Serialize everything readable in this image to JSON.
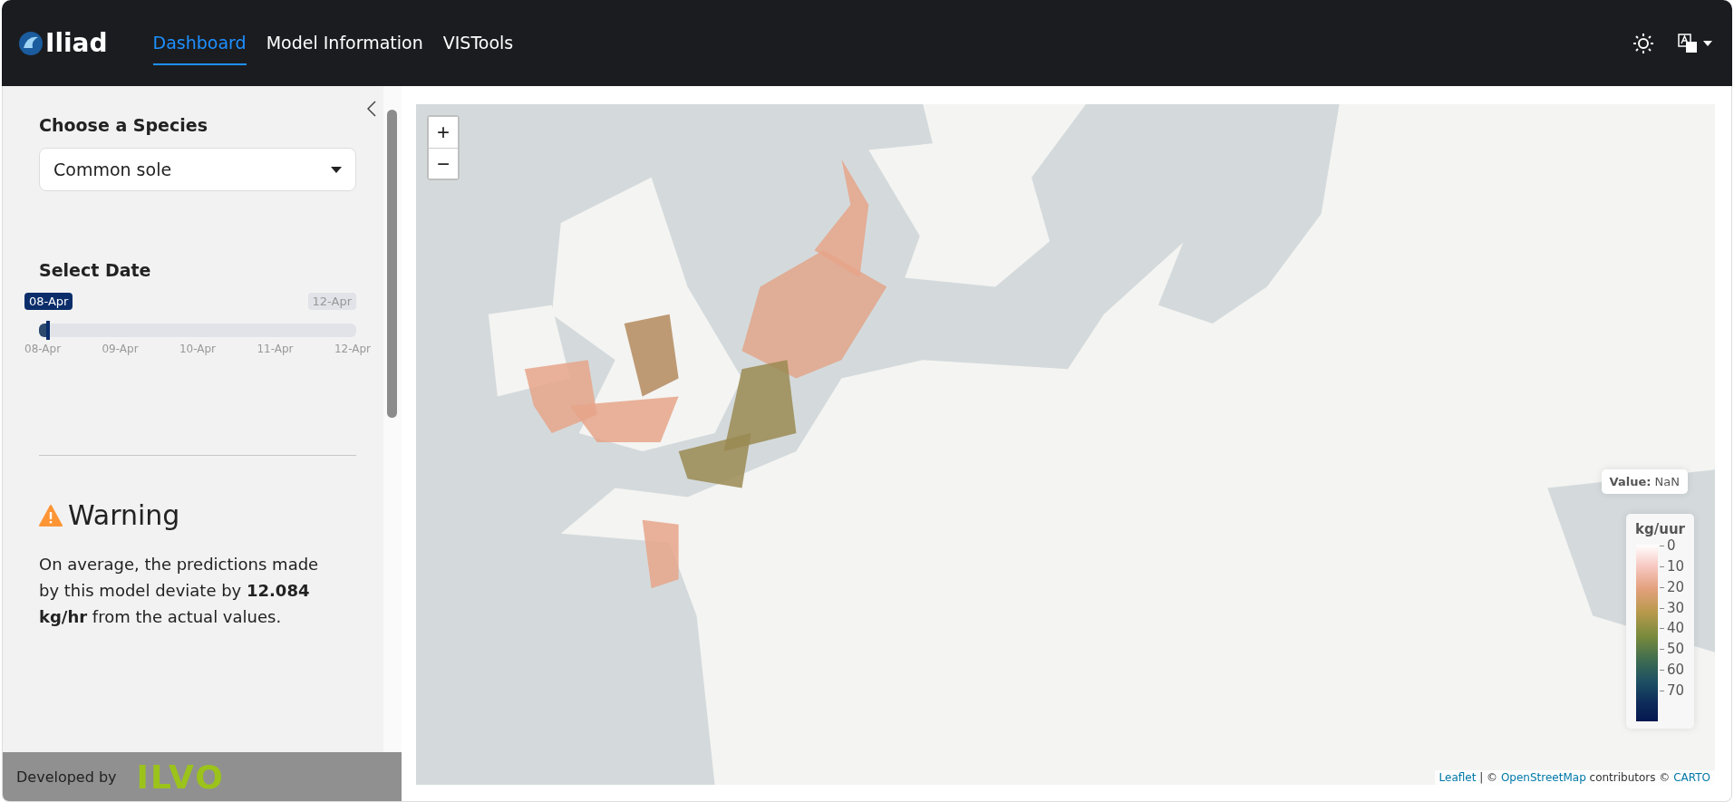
{
  "header": {
    "logo": "Iliad",
    "nav": [
      {
        "label": "Dashboard",
        "selected": true
      },
      {
        "label": "Model Information",
        "selected": false
      },
      {
        "label": "VISTools",
        "selected": false
      }
    ]
  },
  "sidebar": {
    "species": {
      "label": "Choose a Species",
      "value": "Common sole"
    },
    "date": {
      "label": "Select Date",
      "value_label": "08-Apr",
      "max_label": "12-Apr",
      "level": 0,
      "ticks": [
        "08-Apr",
        "09-Apr",
        "10-Apr",
        "11-Apr",
        "12-Apr"
      ]
    },
    "warning": {
      "title": "Warning",
      "text": "On average, the predictions made by this model deviate by **12.084 kg/hr** from the actual values."
    },
    "footer": {
      "text": "Developed by",
      "brand": "ILVO"
    }
  },
  "map": {
    "zoom_in": "+",
    "zoom_out": "−",
    "info": {
      "label": "Value:",
      "value": "NaN"
    },
    "legend": {
      "title": "kg/uur",
      "ticks": [
        "0",
        "10",
        "20",
        "30",
        "40",
        "50",
        "60",
        "70"
      ]
    },
    "attribution": [
      {
        "text": "Leaflet",
        "kind": "link"
      },
      {
        "text": " | © ",
        "kind": "text"
      },
      {
        "text": "OpenStreetMap",
        "kind": "link"
      },
      {
        "text": " contributors © ",
        "kind": "text"
      },
      {
        "text": "CARTO",
        "kind": "link"
      }
    ]
  }
}
